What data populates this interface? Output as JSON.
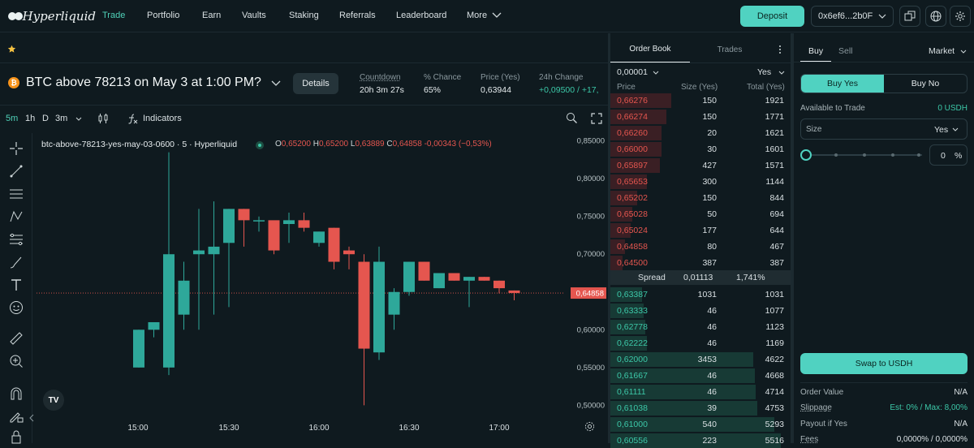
{
  "app": {
    "name": "Hyperliquid"
  },
  "nav": [
    "Trade",
    "Portfolio",
    "Earn",
    "Vaults",
    "Staking",
    "Referrals",
    "Leaderboard",
    "More"
  ],
  "top": {
    "deposit": "Deposit",
    "wallet": "0x6ef6...2b0F"
  },
  "market": {
    "title": "BTC above 78213 on May 3 at 1:00 PM?",
    "details": "Details",
    "stats": [
      {
        "label": "Countdown",
        "value": "20h 3m 27s"
      },
      {
        "label": "% Chance",
        "value": "65%"
      },
      {
        "label": "Price (Yes)",
        "value": "0,63944"
      },
      {
        "label": "24h Change",
        "value": "+0,09500 / +17,"
      }
    ]
  },
  "chart_tools": {
    "intervals": [
      "5m",
      "1h",
      "D",
      "3m"
    ],
    "indicators": "Indicators"
  },
  "chart_data": {
    "type": "candlestick",
    "symbol_line": "btc-above-78213-yes-may-03-0600 · 5 · Hyperliquid",
    "ohlc": {
      "o_label": "O",
      "o": "0,65200",
      "h_label": "H",
      "h": "0,65200",
      "l_label": "L",
      "l": "0,63889",
      "c_label": "C",
      "c": "0,64858",
      "change": "-0,00343 (−0,53%)"
    },
    "y_ticks": [
      "0,85000",
      "0,80000",
      "0,75000",
      "0,70000",
      "0,65000",
      "0,60000",
      "0,55000",
      "0,50000"
    ],
    "y_range": [
      0.495,
      0.855
    ],
    "x_ticks": [
      "15:00",
      "15:30",
      "16:00",
      "16:30",
      "17:00"
    ],
    "last_price": "0,64858",
    "candles": [
      {
        "o": 0.55,
        "h": 0.6,
        "l": 0.55,
        "c": 0.6
      },
      {
        "o": 0.6,
        "h": 0.61,
        "l": 0.59,
        "c": 0.61
      },
      {
        "o": 0.55,
        "h": 0.835,
        "l": 0.54,
        "c": 0.7
      },
      {
        "o": 0.62,
        "h": 0.69,
        "l": 0.6,
        "c": 0.665
      },
      {
        "o": 0.7,
        "h": 0.76,
        "l": 0.6,
        "c": 0.705
      },
      {
        "o": 0.7,
        "h": 0.77,
        "l": 0.62,
        "c": 0.71
      },
      {
        "o": 0.715,
        "h": 0.76,
        "l": 0.63,
        "c": 0.76
      },
      {
        "o": 0.76,
        "h": 0.76,
        "l": 0.71,
        "c": 0.745
      },
      {
        "o": 0.745,
        "h": 0.75,
        "l": 0.73,
        "c": 0.745
      },
      {
        "o": 0.745,
        "h": 0.74,
        "l": 0.7,
        "c": 0.705
      },
      {
        "o": 0.74,
        "h": 0.755,
        "l": 0.715,
        "c": 0.745
      },
      {
        "o": 0.745,
        "h": 0.755,
        "l": 0.73,
        "c": 0.735
      },
      {
        "o": 0.715,
        "h": 0.73,
        "l": 0.71,
        "c": 0.73
      },
      {
        "o": 0.735,
        "h": 0.735,
        "l": 0.68,
        "c": 0.69
      },
      {
        "o": 0.705,
        "h": 0.71,
        "l": 0.68,
        "c": 0.7
      },
      {
        "o": 0.69,
        "h": 0.7,
        "l": 0.5,
        "c": 0.575
      },
      {
        "o": 0.57,
        "h": 0.71,
        "l": 0.56,
        "c": 0.69
      },
      {
        "o": 0.62,
        "h": 0.655,
        "l": 0.6,
        "c": 0.65
      },
      {
        "o": 0.65,
        "h": 0.69,
        "l": 0.645,
        "c": 0.69
      },
      {
        "o": 0.69,
        "h": 0.69,
        "l": 0.665,
        "c": 0.665
      },
      {
        "o": 0.655,
        "h": 0.675,
        "l": 0.655,
        "c": 0.675
      },
      {
        "o": 0.675,
        "h": 0.675,
        "l": 0.665,
        "c": 0.665
      },
      {
        "o": 0.665,
        "h": 0.67,
        "l": 0.63,
        "c": 0.67
      },
      {
        "o": 0.67,
        "h": 0.67,
        "l": 0.665,
        "c": 0.665
      },
      {
        "o": 0.665,
        "h": 0.665,
        "l": 0.648,
        "c": 0.655
      },
      {
        "o": 0.652,
        "h": 0.652,
        "l": 0.639,
        "c": 0.6486
      }
    ]
  },
  "orderbook": {
    "tabs": [
      "Order Book",
      "Trades"
    ],
    "tick": "0,00001",
    "unit": "Yes",
    "headers": [
      "Price",
      "Size (Yes)",
      "Total (Yes)"
    ],
    "asks": [
      [
        "0,66276",
        "150",
        "1921"
      ],
      [
        "0,66274",
        "150",
        "1771"
      ],
      [
        "0,66260",
        "20",
        "1621"
      ],
      [
        "0,66000",
        "30",
        "1601"
      ],
      [
        "0,65897",
        "427",
        "1571"
      ],
      [
        "0,65653",
        "300",
        "1144"
      ],
      [
        "0,65202",
        "150",
        "844"
      ],
      [
        "0,65028",
        "50",
        "694"
      ],
      [
        "0,65024",
        "177",
        "644"
      ],
      [
        "0,64858",
        "80",
        "467"
      ],
      [
        "0,64500",
        "387",
        "387"
      ]
    ],
    "spread": {
      "label": "Spread",
      "value": "0,01113",
      "pct": "1,741%"
    },
    "bids": [
      [
        "0,63387",
        "1031",
        "1031"
      ],
      [
        "0,63333",
        "46",
        "1077"
      ],
      [
        "0,62778",
        "46",
        "1123"
      ],
      [
        "0,62222",
        "46",
        "1169"
      ],
      [
        "0,62000",
        "3453",
        "4622"
      ],
      [
        "0,61667",
        "46",
        "4668"
      ],
      [
        "0,61111",
        "46",
        "4714"
      ],
      [
        "0,61038",
        "39",
        "4753"
      ],
      [
        "0,61000",
        "540",
        "5293"
      ],
      [
        "0,60556",
        "223",
        "5516"
      ]
    ]
  },
  "trade": {
    "tabs": [
      "Buy",
      "Sell"
    ],
    "order_type": "Market",
    "buy_yes": "Buy Yes",
    "buy_no": "Buy No",
    "available_label": "Available to Trade",
    "available_value": "0 USDH",
    "size_label": "Size",
    "size_unit": "Yes",
    "pct_value": "0",
    "pct_sign": "%",
    "swap": "Swap to USDH",
    "info": [
      {
        "label": "Order Value",
        "value": "N/A"
      },
      {
        "label": "Slippage",
        "value": "Est: 0% / Max: 8,00%"
      },
      {
        "label": "Payout if Yes",
        "value": "N/A"
      },
      {
        "label": "Fees",
        "value": "0,0000% / 0,0000%"
      }
    ]
  },
  "colors": {
    "up": "#2ea89a",
    "down": "#e5564f",
    "accent": "#50d2c1",
    "bg": "#0f1a1f"
  }
}
